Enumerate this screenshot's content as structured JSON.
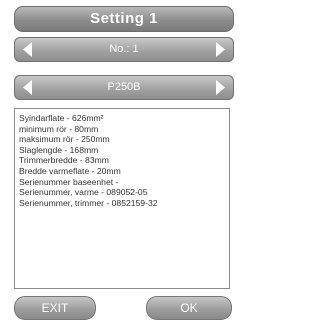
{
  "screen": {
    "title": "Setting 1"
  },
  "selectors": [
    {
      "value": "No.: 1"
    },
    {
      "value": "P250B"
    }
  ],
  "info_lines": [
    "Syindarflate - 626mm²",
    "minimum rör - 80mm",
    "maksimum rör - 250mm",
    "Slaglengde - 168mm",
    "Trimmerbredde - 83mm",
    "Bredde varmeflate - 20mm",
    "Serienummer baseenhet -",
    "Serienummer, varme - 089052-05",
    "Serienummer, trimmer - 0852159-32"
  ],
  "buttons": {
    "exit_label": "EXIT",
    "ok_label": "OK"
  },
  "icons": {
    "prev": "arrow-left-icon",
    "next": "arrow-right-icon"
  }
}
